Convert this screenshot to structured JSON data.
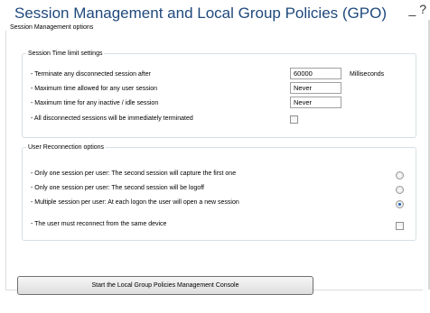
{
  "title": "Session Management and Local Group Policies (GPO)",
  "corner_glyph": "_ ?",
  "options_group": "Session Management options",
  "time_section": {
    "legend": "Session Time limit settings",
    "rows": [
      {
        "label": "- Terminate any disconnected session after",
        "value": "60000",
        "unit": "Milliseconds"
      },
      {
        "label": "- Maximum time allowed for any user session",
        "value": "Never"
      },
      {
        "label": "- Maximum time for any inactive / idle session",
        "value": "Never"
      },
      {
        "label": "- All disconnected sessions will be immediately terminated",
        "checked": false
      }
    ]
  },
  "reconnect_section": {
    "legend": "User Reconnection options",
    "options": [
      {
        "label": "- Only one session per user: The second session will capture the first one",
        "selected": false
      },
      {
        "label": "- Only one session per user: The second session will be logoff",
        "selected": false
      },
      {
        "label": "- Multiple session per user: At each logon the user will open a new session",
        "selected": true
      }
    ],
    "same_device": {
      "label": "- The user must reconnect from the same device",
      "checked": false
    }
  },
  "console_button": "Start the Local Group Policies Management Console"
}
